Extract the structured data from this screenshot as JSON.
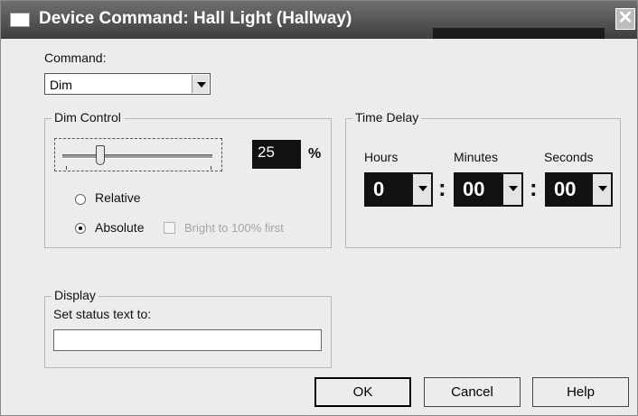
{
  "window": {
    "title": "Device Command: Hall Light (Hallway)",
    "close_glyph": "✕"
  },
  "command": {
    "label": "Command:",
    "selected": "Dim"
  },
  "dim_control": {
    "title": "Dim Control",
    "level_value": "25",
    "level_fraction": 0.25,
    "percent_label": "%",
    "radio_relative": "Relative",
    "radio_absolute": "Absolute",
    "selected_mode": "Absolute",
    "bright_first_label": "Bright to 100% first",
    "bright_first_checked": false
  },
  "time_delay": {
    "title": "Time Delay",
    "hours_label": "Hours",
    "minutes_label": "Minutes",
    "seconds_label": "Seconds",
    "hours_value": "0",
    "minutes_value": "00",
    "seconds_value": "00",
    "separator": ":"
  },
  "display": {
    "title": "Display",
    "status_label": "Set status text to:",
    "status_value": ""
  },
  "buttons": {
    "ok": "OK",
    "cancel": "Cancel",
    "help": "Help"
  },
  "icons": [
    "window-icon",
    "close-icon",
    "dropdown-arrow-icon"
  ]
}
